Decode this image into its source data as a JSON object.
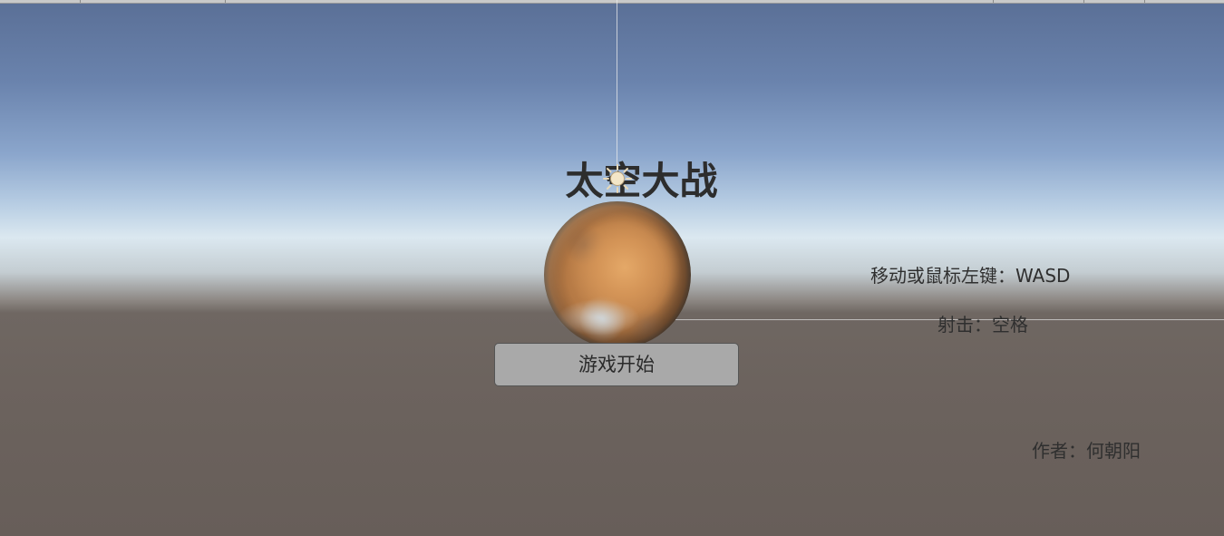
{
  "scene": {
    "title": "太空大战",
    "start_button_label": "游戏开始",
    "controls": {
      "move": "移动或鼠标左键：WASD",
      "shoot": "射击：空格"
    },
    "author": "作者：何朝阳"
  },
  "icons": {
    "sun": "directional-light-gizmo-icon",
    "planet": "mars-planet-image"
  },
  "colors": {
    "title_text": "#2d2d2d",
    "button_bg": "#a9a9a9",
    "info_text": "#2f2f2f",
    "sky_top": "#5a6f96",
    "horizon": "#dbe8f0",
    "ground": "#6c635e"
  }
}
